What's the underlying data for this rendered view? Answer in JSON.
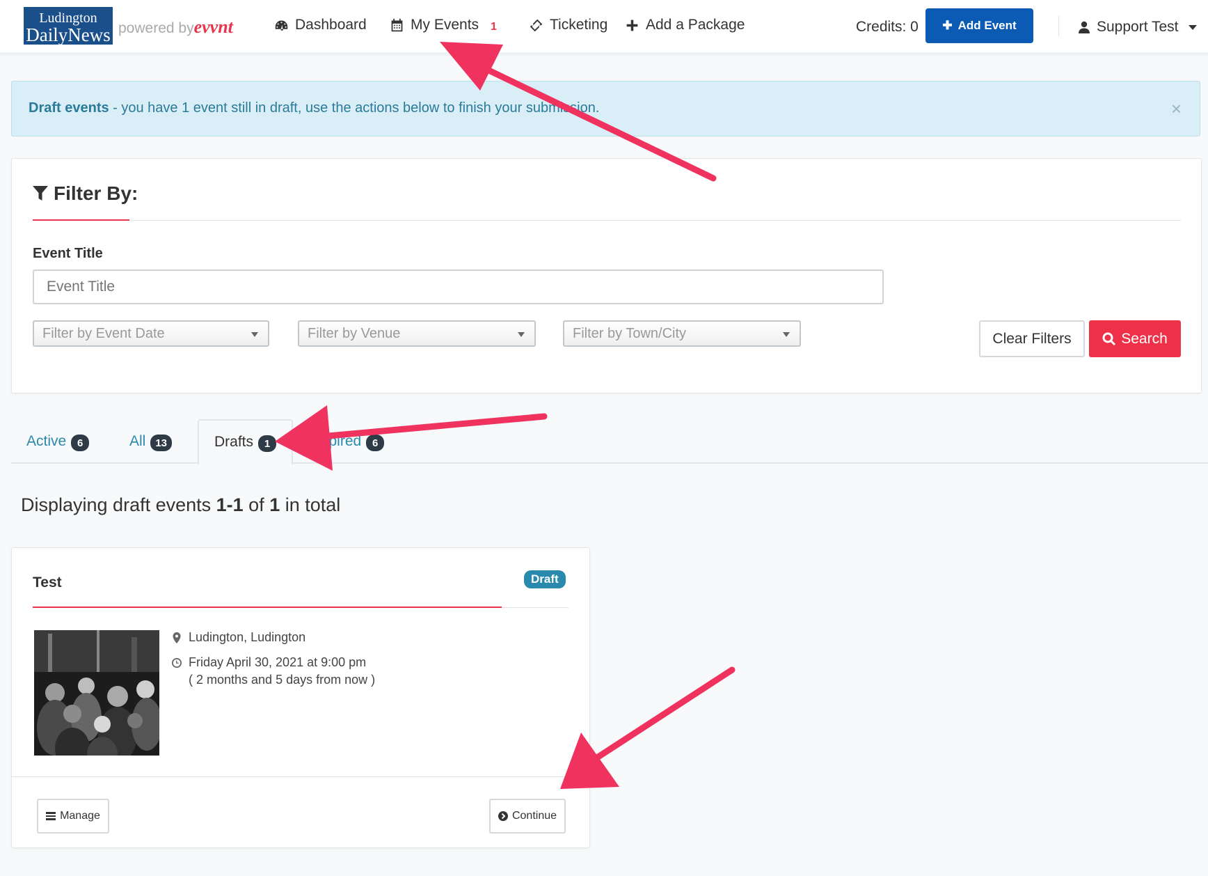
{
  "header": {
    "logo_line1": "Ludington",
    "logo_line2": "DailyNews",
    "powered_by": "powered by",
    "powered_brand": "evvnt",
    "nav": {
      "dashboard": "Dashboard",
      "my_events": "My Events",
      "my_events_count": "1",
      "ticketing": "Ticketing",
      "add_package": "Add a Package"
    },
    "credits": "Credits: 0",
    "add_event": "Add Event",
    "user_name": "Support Test"
  },
  "alert": {
    "strong": "Draft events",
    "text": " - you have 1 event still in draft, use the actions below to finish your submission.",
    "close": "×"
  },
  "filter": {
    "title": "Filter By:",
    "event_title_label": "Event Title",
    "event_title_placeholder": "Event Title",
    "date_select": "Filter by Event Date",
    "venue_select": "Filter by Venue",
    "town_select": "Filter by Town/City",
    "clear_label": "Clear Filters",
    "search_label": "Search"
  },
  "tabs": [
    {
      "label": "Active",
      "count": "6"
    },
    {
      "label": "All",
      "count": "13"
    },
    {
      "label": "Drafts",
      "count": "1"
    },
    {
      "label": "Expired",
      "count": "6"
    }
  ],
  "listing": {
    "prefix": "Displaying draft events ",
    "range": "1-1",
    "mid": " of ",
    "total": "1",
    "suffix": " in total"
  },
  "event": {
    "title": "Test",
    "status": "Draft",
    "location": "Ludington, Ludington",
    "date": "Friday April 30, 2021 at 9:00 pm",
    "relative": "( 2 months and 5 days from now )",
    "manage_label": "Manage",
    "continue_label": "Continue"
  },
  "colors": {
    "brand_blue": "#0b5bb5",
    "accent_red": "#e8354c",
    "annotation_arrow": "#f0325f",
    "link_teal": "#2a8aad"
  }
}
